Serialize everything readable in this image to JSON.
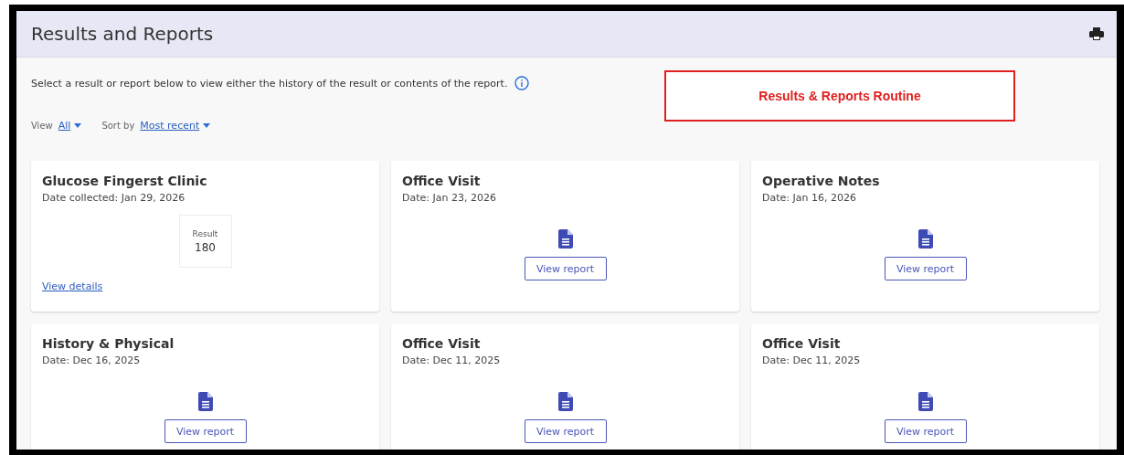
{
  "header": {
    "title": "Results and Reports"
  },
  "intro": {
    "text": "Select a result or report below to view either the history of the result or contents of the report."
  },
  "callout": {
    "text": "Results & Reports Routine"
  },
  "filters": [
    {
      "label": "View",
      "value": "All"
    },
    {
      "label": "Sort by",
      "value": "Most recent"
    }
  ],
  "cards": [
    {
      "kind": "result",
      "title": "Glucose Fingerst Clinic",
      "date": "Date collected: Jan 29, 2026",
      "result_label": "Result",
      "result_value": "180",
      "link": "View details"
    },
    {
      "kind": "report",
      "title": "Office Visit",
      "date": "Date: Jan 23, 2026",
      "button": "View report"
    },
    {
      "kind": "report",
      "title": "Operative Notes",
      "date": "Date: Jan 16, 2026",
      "button": "View report"
    },
    {
      "kind": "report",
      "title": "History & Physical",
      "date": "Date: Dec 16, 2025",
      "button": "View report"
    },
    {
      "kind": "report",
      "title": "Office Visit",
      "date": "Date: Dec 11, 2025",
      "button": "View report"
    },
    {
      "kind": "report",
      "title": "Office Visit",
      "date": "Date: Dec 11, 2025",
      "button": "View report"
    }
  ]
}
